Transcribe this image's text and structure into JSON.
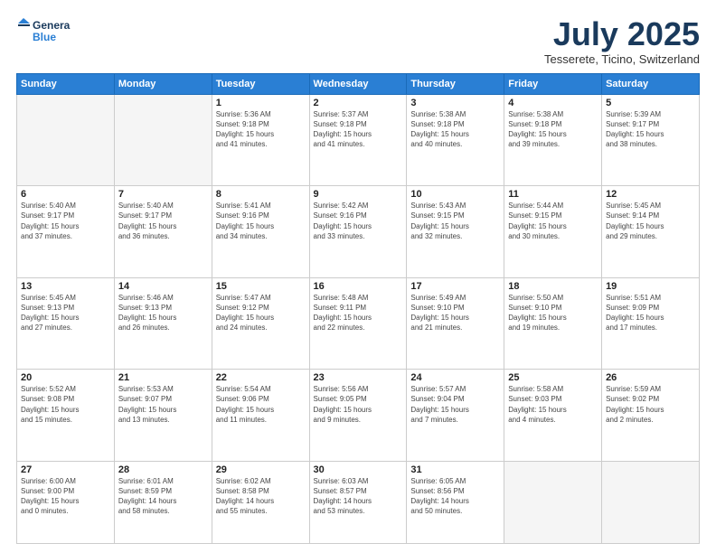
{
  "header": {
    "logo_line1": "General",
    "logo_line2": "Blue",
    "month": "July 2025",
    "location": "Tesserete, Ticino, Switzerland"
  },
  "weekdays": [
    "Sunday",
    "Monday",
    "Tuesday",
    "Wednesday",
    "Thursday",
    "Friday",
    "Saturday"
  ],
  "weeks": [
    [
      {
        "day": "",
        "info": ""
      },
      {
        "day": "",
        "info": ""
      },
      {
        "day": "1",
        "info": "Sunrise: 5:36 AM\nSunset: 9:18 PM\nDaylight: 15 hours\nand 41 minutes."
      },
      {
        "day": "2",
        "info": "Sunrise: 5:37 AM\nSunset: 9:18 PM\nDaylight: 15 hours\nand 41 minutes."
      },
      {
        "day": "3",
        "info": "Sunrise: 5:38 AM\nSunset: 9:18 PM\nDaylight: 15 hours\nand 40 minutes."
      },
      {
        "day": "4",
        "info": "Sunrise: 5:38 AM\nSunset: 9:18 PM\nDaylight: 15 hours\nand 39 minutes."
      },
      {
        "day": "5",
        "info": "Sunrise: 5:39 AM\nSunset: 9:17 PM\nDaylight: 15 hours\nand 38 minutes."
      }
    ],
    [
      {
        "day": "6",
        "info": "Sunrise: 5:40 AM\nSunset: 9:17 PM\nDaylight: 15 hours\nand 37 minutes."
      },
      {
        "day": "7",
        "info": "Sunrise: 5:40 AM\nSunset: 9:17 PM\nDaylight: 15 hours\nand 36 minutes."
      },
      {
        "day": "8",
        "info": "Sunrise: 5:41 AM\nSunset: 9:16 PM\nDaylight: 15 hours\nand 34 minutes."
      },
      {
        "day": "9",
        "info": "Sunrise: 5:42 AM\nSunset: 9:16 PM\nDaylight: 15 hours\nand 33 minutes."
      },
      {
        "day": "10",
        "info": "Sunrise: 5:43 AM\nSunset: 9:15 PM\nDaylight: 15 hours\nand 32 minutes."
      },
      {
        "day": "11",
        "info": "Sunrise: 5:44 AM\nSunset: 9:15 PM\nDaylight: 15 hours\nand 30 minutes."
      },
      {
        "day": "12",
        "info": "Sunrise: 5:45 AM\nSunset: 9:14 PM\nDaylight: 15 hours\nand 29 minutes."
      }
    ],
    [
      {
        "day": "13",
        "info": "Sunrise: 5:45 AM\nSunset: 9:13 PM\nDaylight: 15 hours\nand 27 minutes."
      },
      {
        "day": "14",
        "info": "Sunrise: 5:46 AM\nSunset: 9:13 PM\nDaylight: 15 hours\nand 26 minutes."
      },
      {
        "day": "15",
        "info": "Sunrise: 5:47 AM\nSunset: 9:12 PM\nDaylight: 15 hours\nand 24 minutes."
      },
      {
        "day": "16",
        "info": "Sunrise: 5:48 AM\nSunset: 9:11 PM\nDaylight: 15 hours\nand 22 minutes."
      },
      {
        "day": "17",
        "info": "Sunrise: 5:49 AM\nSunset: 9:10 PM\nDaylight: 15 hours\nand 21 minutes."
      },
      {
        "day": "18",
        "info": "Sunrise: 5:50 AM\nSunset: 9:10 PM\nDaylight: 15 hours\nand 19 minutes."
      },
      {
        "day": "19",
        "info": "Sunrise: 5:51 AM\nSunset: 9:09 PM\nDaylight: 15 hours\nand 17 minutes."
      }
    ],
    [
      {
        "day": "20",
        "info": "Sunrise: 5:52 AM\nSunset: 9:08 PM\nDaylight: 15 hours\nand 15 minutes."
      },
      {
        "day": "21",
        "info": "Sunrise: 5:53 AM\nSunset: 9:07 PM\nDaylight: 15 hours\nand 13 minutes."
      },
      {
        "day": "22",
        "info": "Sunrise: 5:54 AM\nSunset: 9:06 PM\nDaylight: 15 hours\nand 11 minutes."
      },
      {
        "day": "23",
        "info": "Sunrise: 5:56 AM\nSunset: 9:05 PM\nDaylight: 15 hours\nand 9 minutes."
      },
      {
        "day": "24",
        "info": "Sunrise: 5:57 AM\nSunset: 9:04 PM\nDaylight: 15 hours\nand 7 minutes."
      },
      {
        "day": "25",
        "info": "Sunrise: 5:58 AM\nSunset: 9:03 PM\nDaylight: 15 hours\nand 4 minutes."
      },
      {
        "day": "26",
        "info": "Sunrise: 5:59 AM\nSunset: 9:02 PM\nDaylight: 15 hours\nand 2 minutes."
      }
    ],
    [
      {
        "day": "27",
        "info": "Sunrise: 6:00 AM\nSunset: 9:00 PM\nDaylight: 15 hours\nand 0 minutes."
      },
      {
        "day": "28",
        "info": "Sunrise: 6:01 AM\nSunset: 8:59 PM\nDaylight: 14 hours\nand 58 minutes."
      },
      {
        "day": "29",
        "info": "Sunrise: 6:02 AM\nSunset: 8:58 PM\nDaylight: 14 hours\nand 55 minutes."
      },
      {
        "day": "30",
        "info": "Sunrise: 6:03 AM\nSunset: 8:57 PM\nDaylight: 14 hours\nand 53 minutes."
      },
      {
        "day": "31",
        "info": "Sunrise: 6:05 AM\nSunset: 8:56 PM\nDaylight: 14 hours\nand 50 minutes."
      },
      {
        "day": "",
        "info": ""
      },
      {
        "day": "",
        "info": ""
      }
    ]
  ]
}
